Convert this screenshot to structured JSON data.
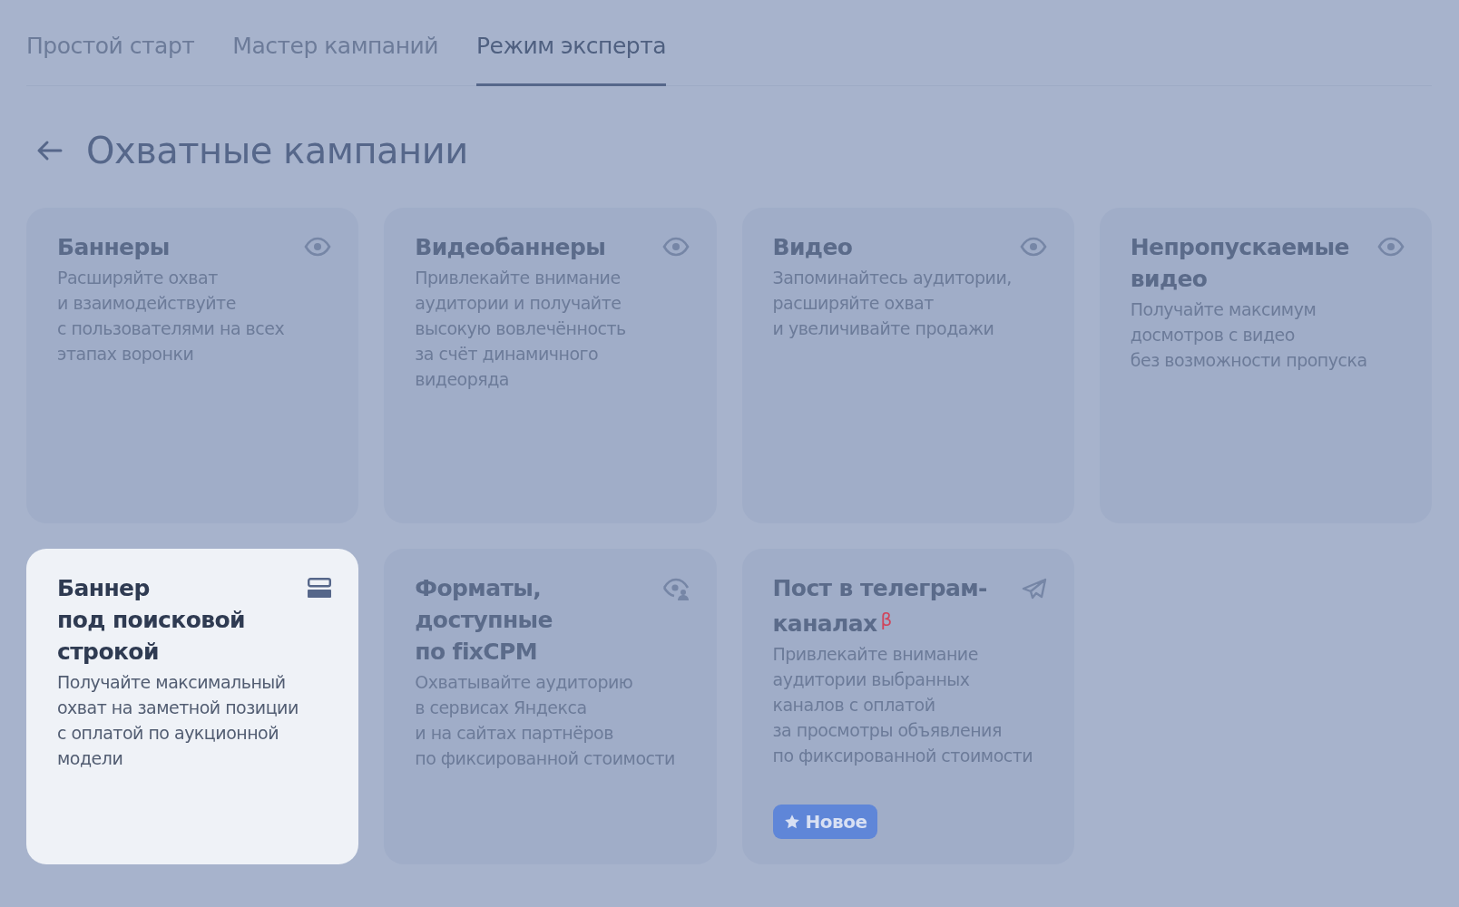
{
  "tabs": [
    {
      "label": "Простой старт",
      "selected": false
    },
    {
      "label": "Мастер кампаний",
      "selected": false
    },
    {
      "label": "Режим эксперта",
      "selected": true
    }
  ],
  "header": {
    "title": "Охватные кампании"
  },
  "cards": [
    {
      "kind": "reach",
      "title": [
        "Баннеры"
      ],
      "description": [
        "Расширяйте охват",
        "и взаимодействуйте",
        "с пользователями на всех",
        "этапах воронки"
      ],
      "selected": false
    },
    {
      "kind": "reach",
      "title": [
        "Видеобаннеры"
      ],
      "description": [
        "Привлекайте внимание",
        "аудитории и получайте",
        "высокую вовлечённость",
        "за счёт динамичного",
        "видеоряда"
      ],
      "selected": false
    },
    {
      "kind": "reach",
      "title": [
        "Видео"
      ],
      "description": [
        "Запоминайтесь аудитории,",
        "расширяйте охват",
        "и увеличивайте продажи"
      ],
      "selected": false
    },
    {
      "kind": "reach",
      "title": [
        "Непропускаемые",
        "видео"
      ],
      "description": [
        "Получайте максимум",
        "досмотров с видео",
        "без возможности пропуска"
      ],
      "selected": false
    },
    {
      "kind": "banner",
      "title": [
        "Баннер",
        "под поисковой",
        "строкой"
      ],
      "description": [
        "Получайте максимальный",
        "охват на заметной позиции",
        "с оплатой по аукционной",
        "модели"
      ],
      "selected": true
    },
    {
      "kind": "fixcpm",
      "title": [
        "Форматы,",
        "доступные",
        "по fixCPM"
      ],
      "description": [
        "Охватывайте аудиторию",
        "в сервисах Яндекса",
        "и на сайтах партнёров",
        "по фиксированной стоимости"
      ],
      "selected": false
    },
    {
      "kind": "telegram",
      "title": [
        "Пост в телеграм-",
        "каналах"
      ],
      "title_mark": "β",
      "description": [
        "Привлекайте внимание",
        "аудитории выбранных",
        "каналов с оплатой",
        "за просмотры объявления",
        "по фиксированной стоимости"
      ],
      "badge": "Новое",
      "selected": false
    }
  ]
}
